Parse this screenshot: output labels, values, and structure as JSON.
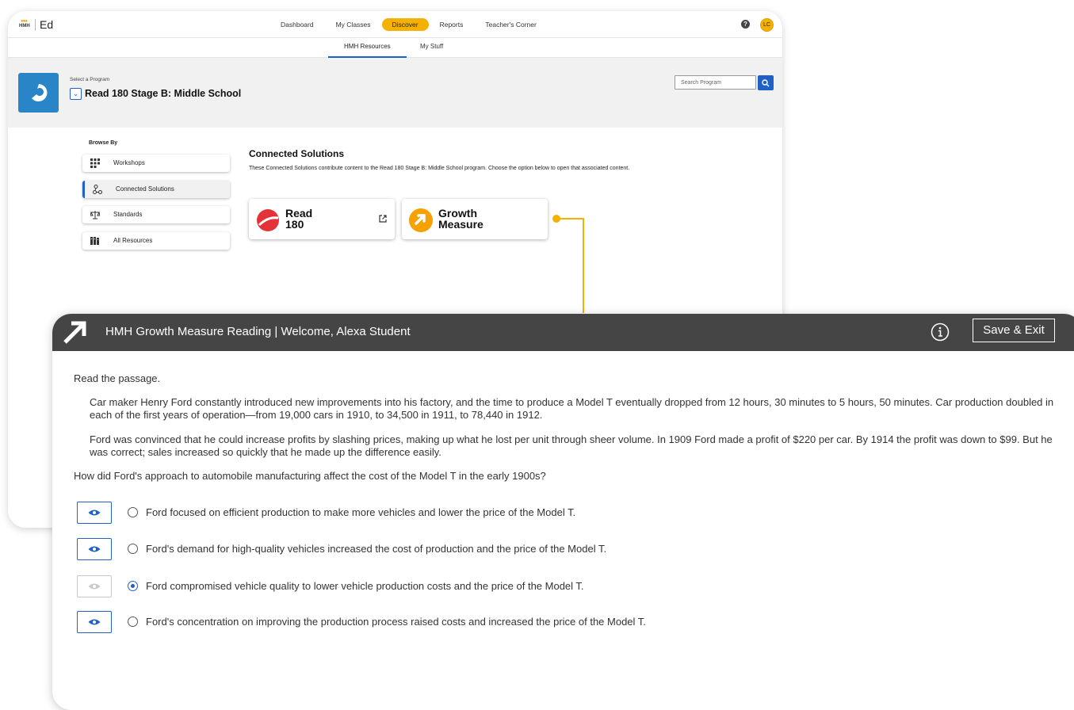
{
  "back": {
    "logo_text": "HMH",
    "app_name": "Ed",
    "nav": [
      "Dashboard",
      "My Classes",
      "Discover",
      "Reports",
      "Teacher's Corner"
    ],
    "nav_active": "Discover",
    "help_glyph": "?",
    "avatar_initials": "LC",
    "subnav": [
      "HMH Resources",
      "My Stuff"
    ],
    "select_label": "Select a Program",
    "program_name": "Read 180 Stage B: Middle School",
    "search_placeholder": "Search Program",
    "browse_label": "Browse By",
    "browse_items": [
      "Workshops",
      "Connected Solutions",
      "Standards",
      "All Resources"
    ],
    "browse_active": "Connected Solutions",
    "section_title": "Connected Solutions",
    "section_desc": "These Connected Solutions contribute content to the Read 180 Stage B: Middle School program. Choose the option below to open that associated content.",
    "cards": [
      {
        "line1": "Read",
        "line2": "180",
        "icon": "read180-logo-icon",
        "external": true
      },
      {
        "line1": "Growth",
        "line2": "Measure",
        "icon": "growth-measure-logo-icon",
        "external": false
      }
    ],
    "colors": {
      "accent": "#1f61c4",
      "highlight": "#f5b100",
      "program_icon": "#2a84c8"
    }
  },
  "front": {
    "title": "HMH Growth Measure Reading",
    "welcome": "Welcome, Alexa Student",
    "save_label": "Save & Exit",
    "instruction": "Read the passage.",
    "passage": [
      "Car maker Henry Ford constantly introduced new improvements into his factory, and the time to produce a Model T eventually dropped from 12 hours, 30 minutes to 5 hours, 50 minutes. Car production doubled in each of the first years of operation—from 19,000 cars in 1910, to 34,500 in 1911, to 78,440 in 1912.",
      "Ford was convinced that he could increase profits by slashing prices, making up what he lost per unit through sheer volume. In 1909 Ford made a profit of $220 per car. By 1914 the profit was down to $99. But he was correct; sales increased so quickly that he made up the difference easily."
    ],
    "question": "How did Ford's approach to automobile manufacturing affect the cost of the Model T in the early 1900s?",
    "options": [
      {
        "text": "Ford focused on efficient production to make more vehicles and lower the price of the Model T.",
        "selected": false
      },
      {
        "text": "Ford's demand for high-quality vehicles increased the cost of production and the price of the Model T.",
        "selected": false
      },
      {
        "text": "Ford compromised vehicle quality to lower vehicle production costs and the price of the Model T.",
        "selected": true
      },
      {
        "text": "Ford's concentration on improving the production process raised costs and increased the price of the Model T.",
        "selected": false
      }
    ]
  }
}
